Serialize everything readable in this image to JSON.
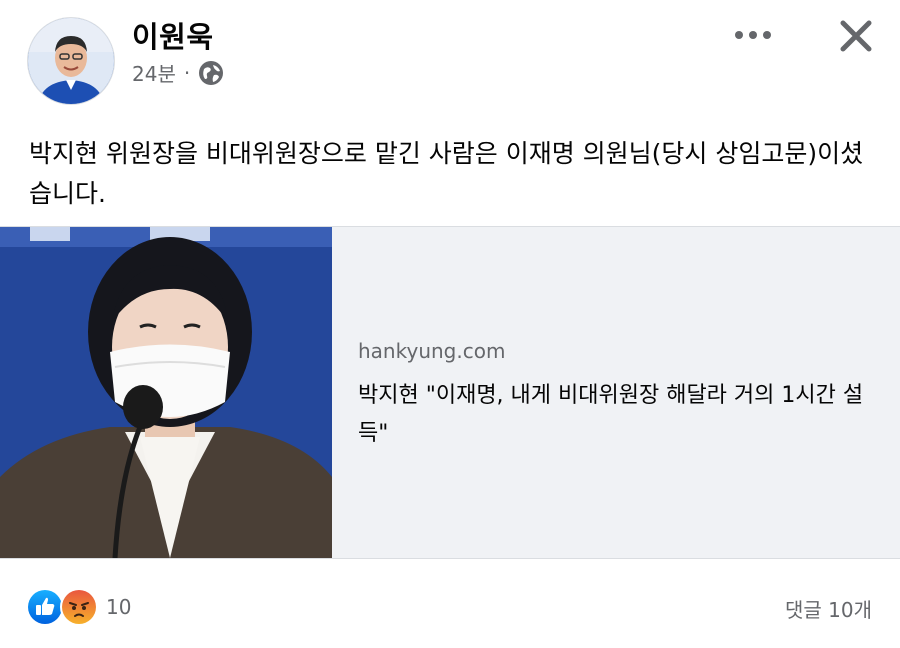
{
  "header": {
    "author_name": "이원욱",
    "time": "24분",
    "privacy_icon": "globe-icon",
    "more_icon": "more-dots-icon",
    "close_icon": "close-icon"
  },
  "post": {
    "text": "박지현 위원장을 비대위원장으로 맡긴 사람은 이재명 의원님(당시 상임고문)이셨습니다."
  },
  "link_card": {
    "domain": "hankyung.com",
    "title": "박지현 \"이재명, 내게 비대위원장 해달라 거의 1시간 설득\""
  },
  "footer": {
    "reaction_icons": [
      "like-icon",
      "angry-icon"
    ],
    "reaction_count": "10",
    "comments_label": "댓글 10개"
  },
  "colors": {
    "like_blue": "#1877f2",
    "angry_orange": "#f4772a",
    "secondary_text": "#65676b",
    "card_background": "#f0f2f5"
  }
}
